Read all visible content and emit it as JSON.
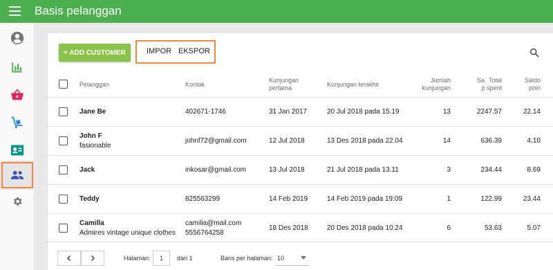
{
  "app": {
    "title": "Basis pelanggan"
  },
  "sidebar": {
    "items": [
      {
        "icon": "account-circle-icon",
        "active": false
      },
      {
        "icon": "bar-chart-icon",
        "active": false
      },
      {
        "icon": "basket-icon",
        "active": false
      },
      {
        "icon": "inventory-icon",
        "active": false
      },
      {
        "icon": "employee-card-icon",
        "active": false
      },
      {
        "icon": "people-icon",
        "active": true
      },
      {
        "icon": "gear-icon",
        "active": false
      }
    ]
  },
  "toolbar": {
    "add_label": "+ ADD CUSTOMER",
    "import_label": "IMPOR",
    "export_label": "EKSPOR",
    "search_icon": "search-icon",
    "accent_color": "#8bc34a",
    "highlight_color": "#f0883a"
  },
  "table": {
    "headers": {
      "customer": "Pelanggan",
      "contact": "Kontak",
      "first_visit_1": "Kunjungan",
      "first_visit_2": "pertama",
      "last_visit": "Kunjungan terakhir",
      "visits_1": "Jumlah",
      "visits_2": "kunjungan",
      "sa_1": "Sa",
      "sa_2": "",
      "spent_1": "Total",
      "spent_2": "p spent",
      "points_1": "Saldo",
      "points_2": "poin"
    },
    "rows": [
      {
        "name": "Jane Be",
        "note": "",
        "contact": "402671-1746",
        "contact2": "",
        "first_visit": "31 Jan 2017",
        "last_visit": "20 Jul 2018 pada 15.19",
        "visits": "13",
        "spent": "2247.57",
        "points": "22.14"
      },
      {
        "name": "John F",
        "note": "fasionable",
        "contact": "johnf72@gmail.com",
        "contact2": "",
        "first_visit": "12 Jul 2018",
        "last_visit": "13 Des 2018 pada 22.04",
        "visits": "14",
        "spent": "636.39",
        "points": "4.10"
      },
      {
        "name": "Jack",
        "note": "",
        "contact": "inkosar@gmail.com",
        "contact2": "",
        "first_visit": "13 Jul 2018",
        "last_visit": "21 Jul 2018 pada 13.11",
        "visits": "3",
        "spent": "234.44",
        "points": "8.69"
      },
      {
        "name": "Teddy",
        "note": "",
        "contact": "825563299",
        "contact2": "",
        "first_visit": "14 Feb 2019",
        "last_visit": "14 Feb 2019 pada 19.09",
        "visits": "1",
        "spent": "122.99",
        "points": "23.44"
      },
      {
        "name": "Camilla",
        "note": "Admires vintage unique clothes",
        "contact": "camilia@mail.com",
        "contact2": "5556764258",
        "first_visit": "18 Des 2018",
        "last_visit": "20 Des 2018 pada 10.24",
        "visits": "6",
        "spent": "53.63",
        "points": "5.07"
      }
    ]
  },
  "pagination": {
    "page_label": "Halaman:",
    "page_value": "1",
    "of_label": "dari 1",
    "rows_label": "Baris per halaman:",
    "rows_value": "10"
  }
}
